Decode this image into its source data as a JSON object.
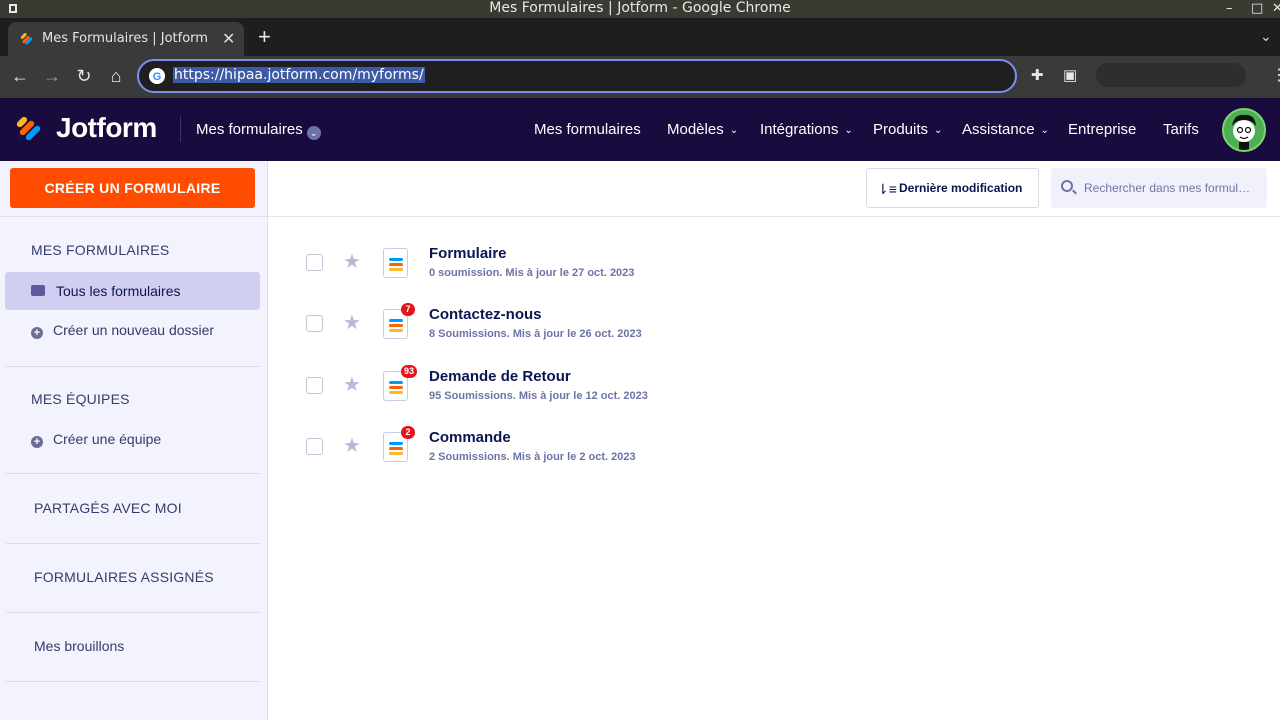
{
  "os": {
    "window_title": "Mes Formulaires | Jotform - Google Chrome",
    "min_glyph": "–",
    "max_glyph": "□",
    "close_glyph": "✕"
  },
  "browser": {
    "tab_title": "Mes Formulaires | Jotform",
    "tab_close_glyph": "✕",
    "new_tab_glyph": "+",
    "url": "https://hipaa.jotform.com/myforms/"
  },
  "header": {
    "logo_text": "Jotform",
    "myforms_label": "Mes formulaires",
    "nav": [
      {
        "label": "Mes formulaires",
        "has_caret": false
      },
      {
        "label": "Modèles",
        "has_caret": true
      },
      {
        "label": "Intégrations",
        "has_caret": true
      },
      {
        "label": "Produits",
        "has_caret": true
      },
      {
        "label": "Assistance",
        "has_caret": true
      },
      {
        "label": "Entreprise",
        "has_caret": false
      },
      {
        "label": "Tarifs",
        "has_caret": false
      }
    ]
  },
  "sidebar": {
    "create_button": "CRÉER UN FORMULAIRE",
    "my_forms_heading": "MES FORMULAIRES",
    "all_forms": "Tous les formulaires",
    "new_folder": "Créer un nouveau dossier",
    "my_teams_heading": "MES ÉQUIPES",
    "create_team": "Créer une équipe",
    "shared_with_me": "PARTAGÉS AVEC MOI",
    "assigned_forms": "FORMULAIRES ASSIGNÉS",
    "drafts": "Mes brouillons"
  },
  "toolbar": {
    "sort_label": "Dernière modification",
    "search_placeholder": "Rechercher dans mes formulaires"
  },
  "forms": [
    {
      "title": "Formulaire",
      "meta": "0 soumission. Mis à jour le 27 oct. 2023",
      "badge": ""
    },
    {
      "title": "Contactez-nous",
      "meta": "8 Soumissions. Mis à jour le 26 oct. 2023",
      "badge": "7"
    },
    {
      "title": "Demande de Retour",
      "meta": "95 Soumissions. Mis à jour le 12 oct. 2023",
      "badge": "93"
    },
    {
      "title": "Commande",
      "meta": "2 Soumissions. Mis à jour le 2 oct. 2023",
      "badge": "2"
    }
  ],
  "colors": {
    "header_bg": "#190b3d",
    "create_button": "#ff4c00",
    "sidebar_bg": "#f3f3fe",
    "active_item": "#d0cff2",
    "badge": "#e3151a"
  }
}
